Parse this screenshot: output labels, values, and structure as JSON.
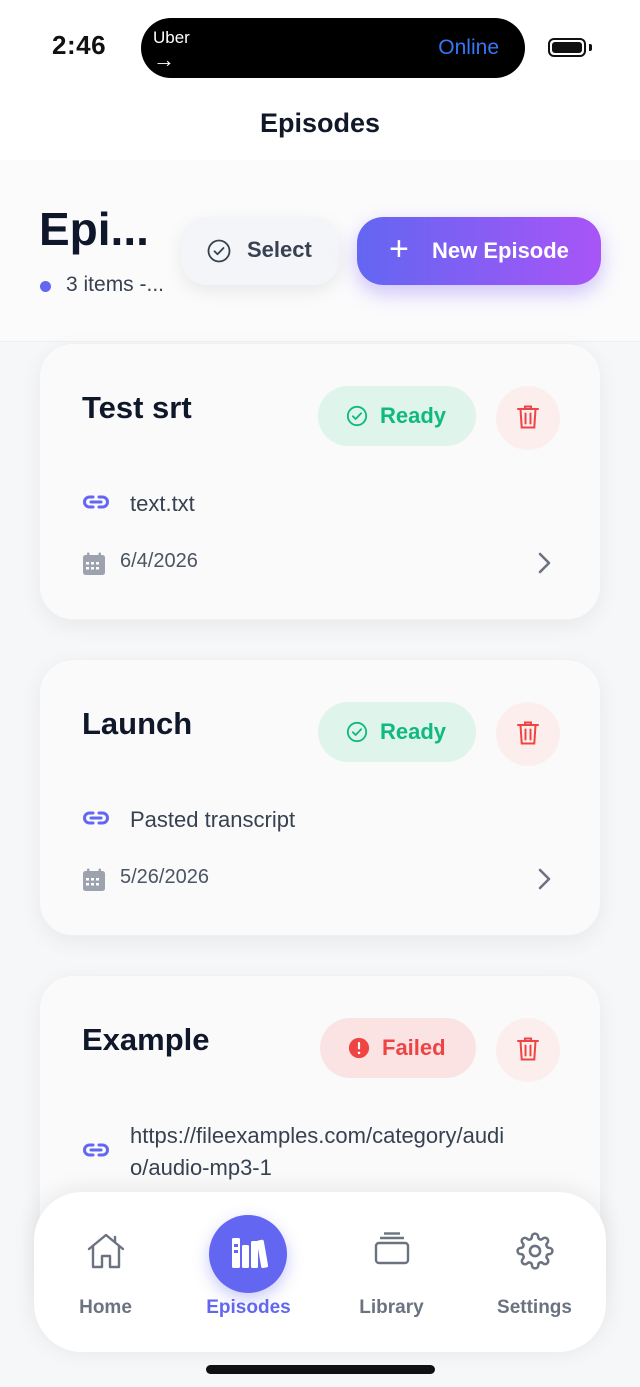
{
  "status_bar": {
    "time": "2:46",
    "live_activity": {
      "app": "Uber",
      "arrow": "→",
      "status": "Online"
    }
  },
  "nav": {
    "title": "Episodes"
  },
  "header": {
    "title": "Epi...",
    "subtitle": "3 items -...",
    "select_label": "Select",
    "new_episode_label": "New Episode",
    "new_episode_icon": "+"
  },
  "episodes": [
    {
      "title": "Test srt",
      "status": "Ready",
      "source": "text.txt",
      "date": "6/4/2026"
    },
    {
      "title": "Launch",
      "status": "Ready",
      "source": "Pasted transcript",
      "date": "5/26/2026"
    },
    {
      "title": "Example",
      "status": "Failed",
      "source": "https://fileexamples.com/category/audio/audio-mp3-1",
      "date": ""
    }
  ],
  "tabs": [
    {
      "label": "Home",
      "icon": "home-icon",
      "active": false
    },
    {
      "label": "Episodes",
      "icon": "episodes-icon",
      "active": true
    },
    {
      "label": "Library",
      "icon": "library-icon",
      "active": false
    },
    {
      "label": "Settings",
      "icon": "gear-icon",
      "active": false
    }
  ],
  "colors": {
    "accent": "#6366f1",
    "accent_gradient_end": "#a855f7",
    "ready": "#10b981",
    "failed": "#ef4444",
    "online": "#3478f6"
  }
}
